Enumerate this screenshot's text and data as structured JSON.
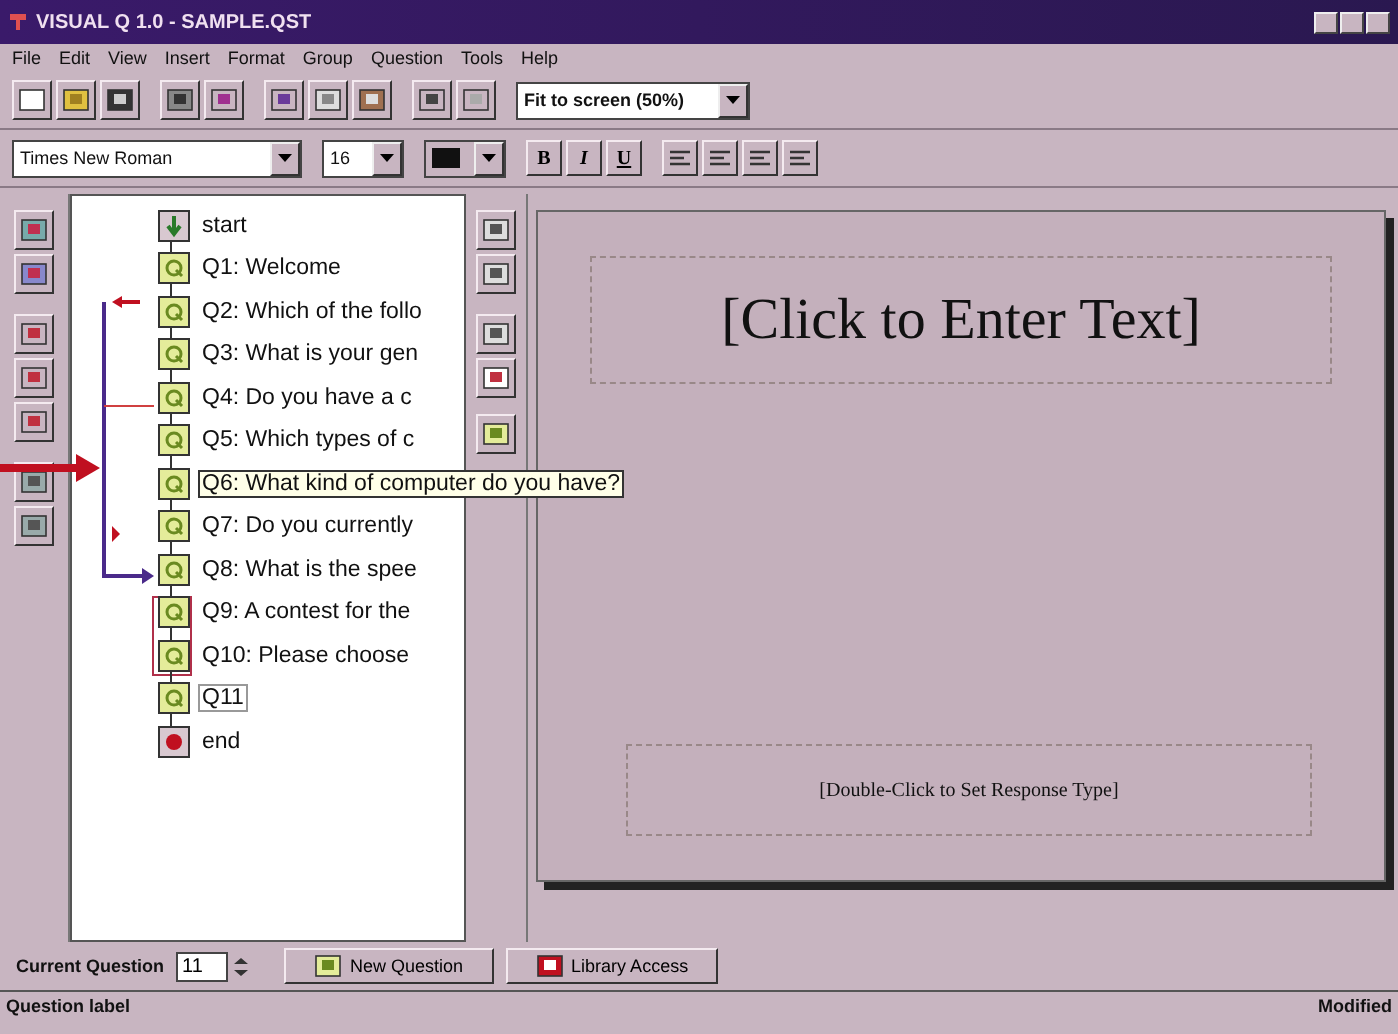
{
  "window": {
    "title": "VISUAL Q 1.0 - SAMPLE.QST"
  },
  "menu": [
    "File",
    "Edit",
    "View",
    "Insert",
    "Format",
    "Group",
    "Question",
    "Tools",
    "Help"
  ],
  "toolbar": {
    "zoom": "Fit to screen (50%)"
  },
  "format_bar": {
    "font": "Times New Roman",
    "size": "16",
    "styles": [
      "B",
      "I",
      "U"
    ]
  },
  "tree": {
    "items": [
      {
        "kind": "start",
        "label": "start",
        "grouped": false,
        "editing": false,
        "tooltip": false
      },
      {
        "kind": "question",
        "label": "Q1: Welcome",
        "grouped": false,
        "editing": false,
        "tooltip": false
      },
      {
        "kind": "question",
        "label": "Q2: Which of the follo",
        "grouped": false,
        "editing": false,
        "tooltip": false
      },
      {
        "kind": "question",
        "label": "Q3: What is your gen",
        "grouped": false,
        "editing": false,
        "tooltip": false
      },
      {
        "kind": "question",
        "label": "Q4: Do you have  a c",
        "grouped": false,
        "editing": false,
        "tooltip": false
      },
      {
        "kind": "question",
        "label": "Q5: Which types of c",
        "grouped": false,
        "editing": false,
        "tooltip": false
      },
      {
        "kind": "question",
        "label": "Q6: What kind of computer do you have?",
        "grouped": false,
        "editing": false,
        "tooltip": true
      },
      {
        "kind": "question",
        "label": "Q7: Do you currently",
        "grouped": false,
        "editing": false,
        "tooltip": false
      },
      {
        "kind": "question",
        "label": "Q8: What is the spee",
        "grouped": false,
        "editing": false,
        "tooltip": false
      },
      {
        "kind": "question",
        "label": "Q9: A contest for the",
        "grouped": true,
        "editing": false,
        "tooltip": false
      },
      {
        "kind": "question",
        "label": "Q10: Please choose",
        "grouped": true,
        "editing": false,
        "tooltip": false
      },
      {
        "kind": "question",
        "label": "Q11",
        "grouped": false,
        "editing": true,
        "tooltip": false
      },
      {
        "kind": "end",
        "label": "end",
        "grouped": false,
        "editing": false,
        "tooltip": false
      }
    ]
  },
  "page": {
    "title_placeholder": "[Click to Enter Text]",
    "response_placeholder": "[Double-Click to Set Response Type]"
  },
  "bottom_bar": {
    "label": "Current Question",
    "value": "11",
    "buttons": [
      "New Question",
      "Library Access"
    ]
  },
  "status_bar": {
    "left": "Question label",
    "right": "Modified"
  }
}
